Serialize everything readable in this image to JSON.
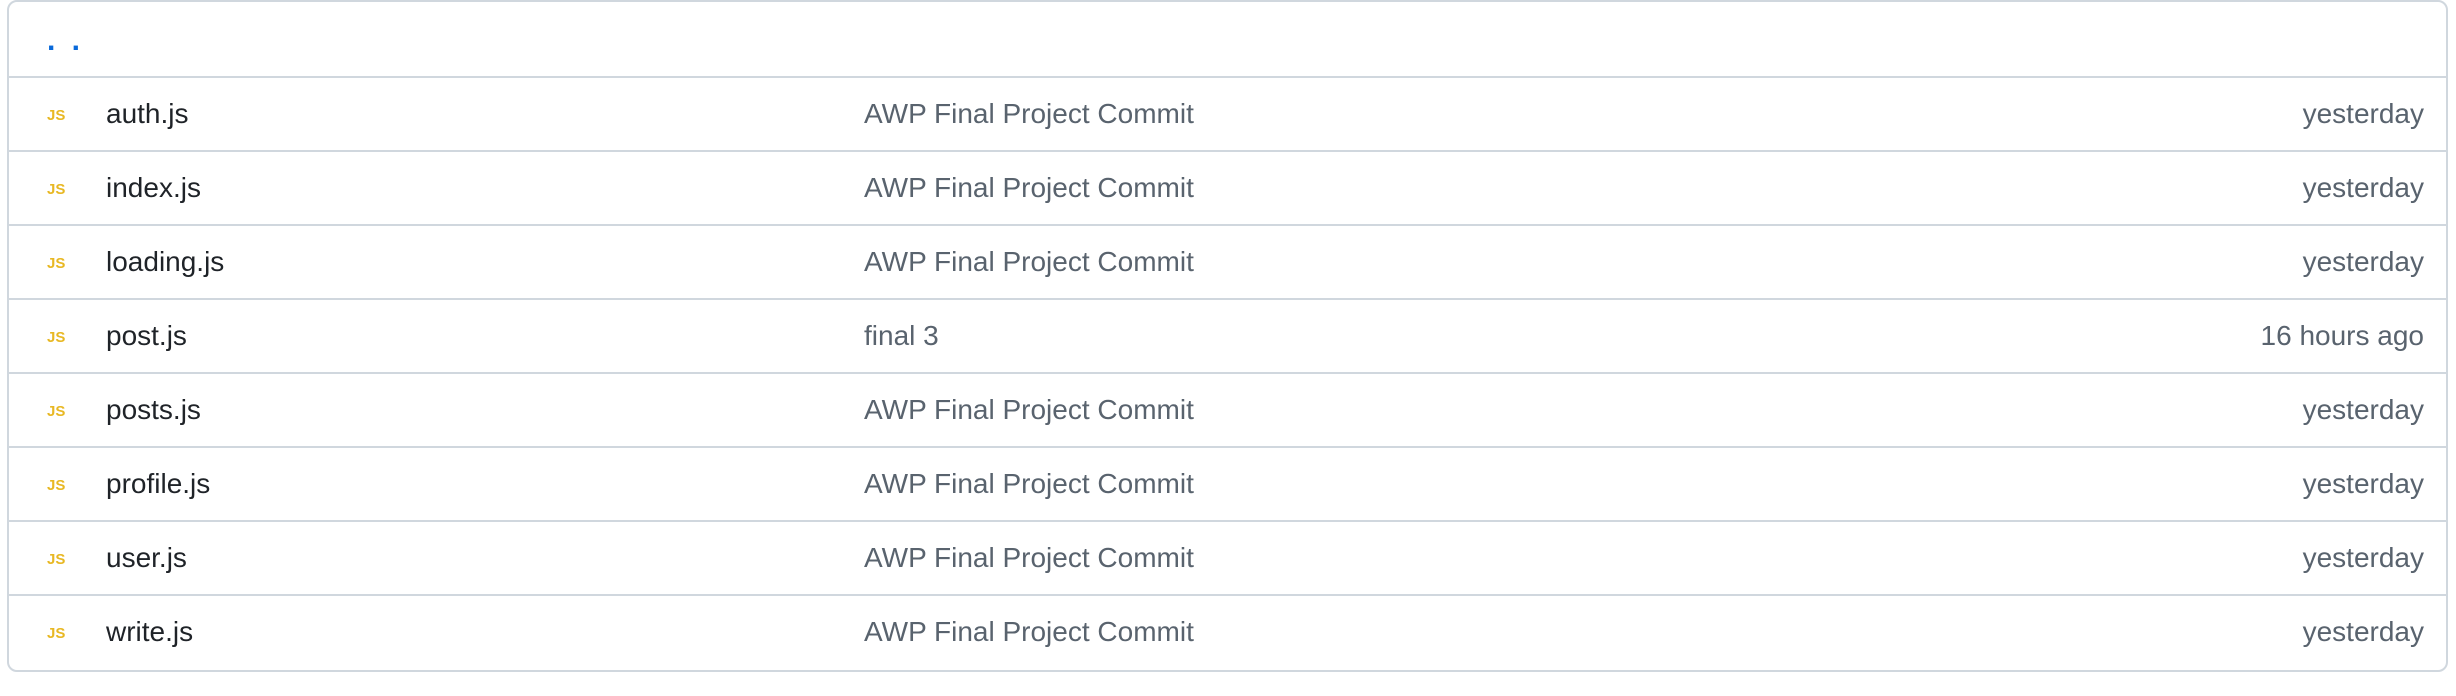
{
  "parent_link": {
    "label": ". ."
  },
  "colors": {
    "js_icon": "#e8b824",
    "border": "#d0d7de",
    "link": "#0969da",
    "muted_text": "#59636e"
  },
  "files": [
    {
      "icon": "javascript-file-icon",
      "name": "auth.js",
      "message": "AWP Final Project Commit",
      "time": "yesterday"
    },
    {
      "icon": "javascript-file-icon",
      "name": "index.js",
      "message": "AWP Final Project Commit",
      "time": "yesterday"
    },
    {
      "icon": "javascript-file-icon",
      "name": "loading.js",
      "message": "AWP Final Project Commit",
      "time": "yesterday"
    },
    {
      "icon": "javascript-file-icon",
      "name": "post.js",
      "message": "final 3",
      "time": "16 hours ago"
    },
    {
      "icon": "javascript-file-icon",
      "name": "posts.js",
      "message": "AWP Final Project Commit",
      "time": "yesterday"
    },
    {
      "icon": "javascript-file-icon",
      "name": "profile.js",
      "message": "AWP Final Project Commit",
      "time": "yesterday"
    },
    {
      "icon": "javascript-file-icon",
      "name": "user.js",
      "message": "AWP Final Project Commit",
      "time": "yesterday"
    },
    {
      "icon": "javascript-file-icon",
      "name": "write.js",
      "message": "AWP Final Project Commit",
      "time": "yesterday"
    }
  ]
}
